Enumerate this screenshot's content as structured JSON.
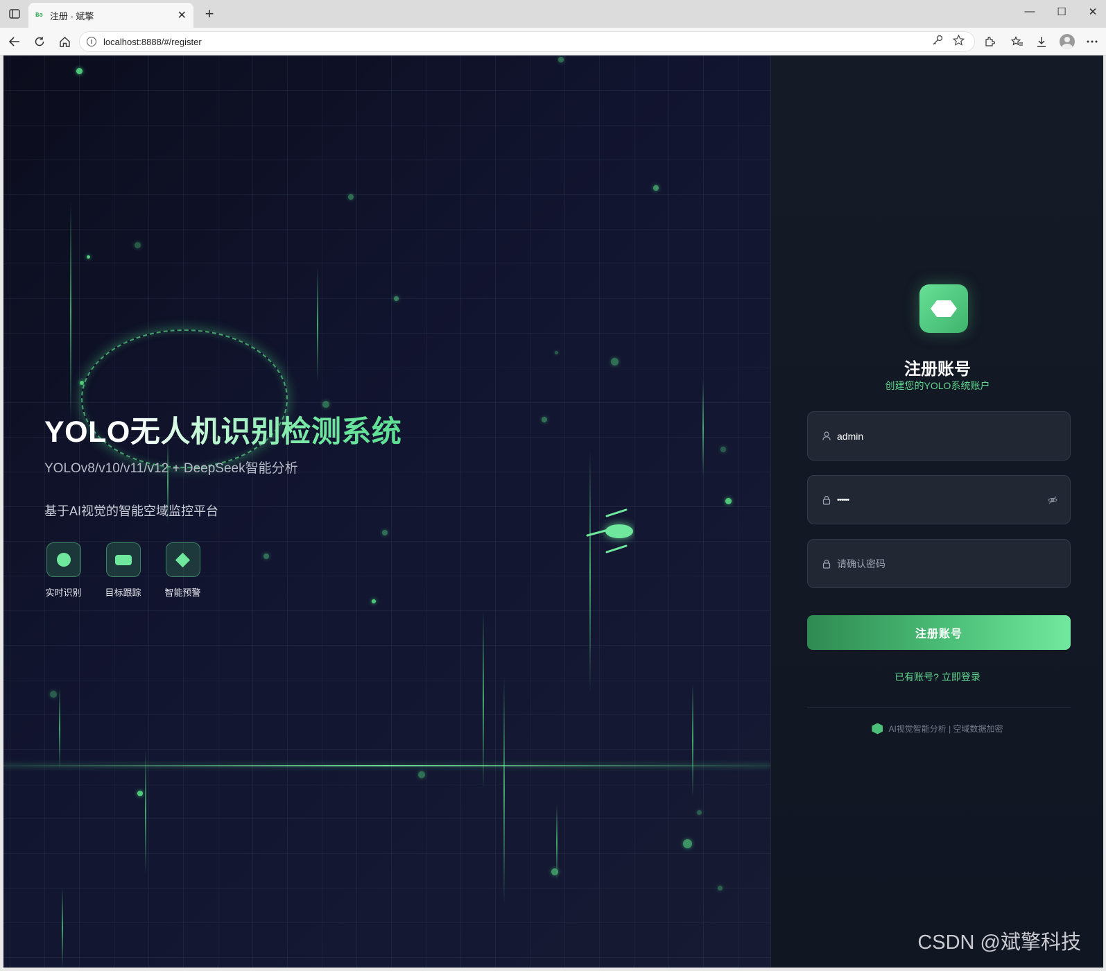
{
  "browser": {
    "tab_favicon": "Bə",
    "tab_title": "注册 - 斌擎",
    "tab_close": "✕",
    "new_tab": "+",
    "url": "localhost:8888/#/register",
    "window_controls": {
      "minimize": "—",
      "maximize": "☐",
      "close": "✕"
    },
    "icons": [
      "sidebar-toggle-icon",
      "back-icon",
      "refresh-icon",
      "home-icon",
      "info-icon",
      "key-icon",
      "star-icon",
      "extensions-icon",
      "favorites-icon",
      "download-icon",
      "profile-icon",
      "more-icon"
    ]
  },
  "hero": {
    "title_yolo": "YOLO",
    "title_rest": "无人机识别检测系统",
    "subtitle": "YOLOv8/v10/v11/v12 + DeepSeek智能分析",
    "description": "基于AI视觉的智能空域监控平台",
    "features": [
      {
        "label": "实时识别",
        "icon": "circle-icon"
      },
      {
        "label": "目标跟踪",
        "icon": "rect-icon"
      },
      {
        "label": "智能预警",
        "icon": "diamond-icon"
      }
    ]
  },
  "register": {
    "title": "注册账号",
    "subtitle": "创建您的YOLO系统账户",
    "username_value": "admin",
    "password_value": "••••••",
    "confirm_placeholder": "请确认密码",
    "submit_label": "注册账号",
    "login_link": "已有账号? 立即登录",
    "footer_text": "AI视觉智能分析 | 空域数据加密"
  },
  "watermark": "CSDN @斌擎科技",
  "colors": {
    "accent": "#5fd68e",
    "accent_dark": "#2f8a52",
    "panel_bg": "#141a26",
    "hero_bg": "#0e1020"
  }
}
